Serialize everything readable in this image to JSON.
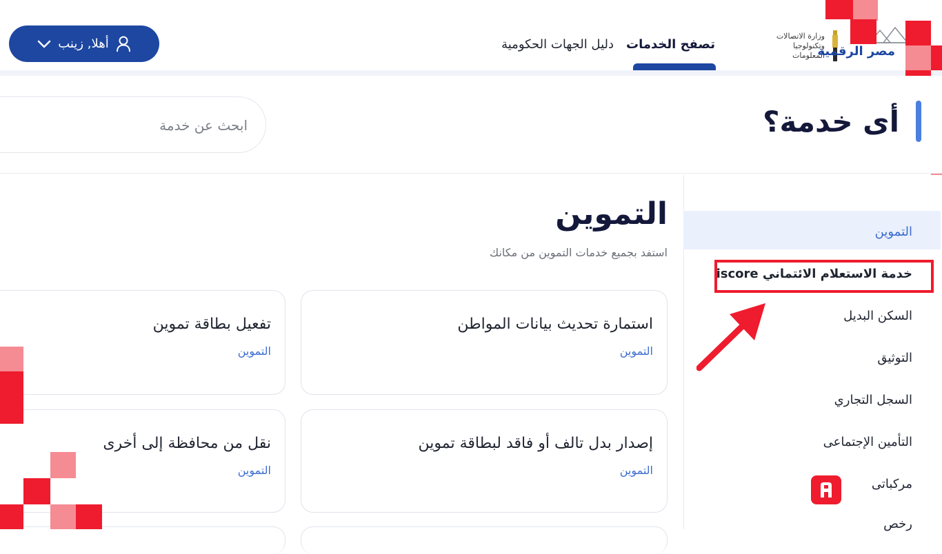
{
  "header": {
    "user_greeting": "أهلا, زينب",
    "nav": {
      "browse_services": "تصفح الخدمات",
      "gov_directory": "دليل الجهات الحكومية"
    },
    "ministry_logo_text": "وزارة الاتصالات\nوتكنولوجيا المعلومات",
    "portal_logo_text": "مصر الرقمية"
  },
  "search": {
    "heading": "أى خدمة؟",
    "placeholder": "ابحث عن خدمة"
  },
  "sidebar": {
    "items": [
      {
        "label": "التموين",
        "active": true
      },
      {
        "label": "خدمة الاستعلام الائتماني iscore",
        "highlighted": true
      },
      {
        "label": "السكن البديل"
      },
      {
        "label": "التوثيق"
      },
      {
        "label": "السجل التجاري"
      },
      {
        "label": "التأمين الإجتماعى"
      },
      {
        "label": "مركباتى",
        "icon": "car-app-icon"
      },
      {
        "label": "رخص"
      }
    ]
  },
  "category": {
    "title": "التموين",
    "subtitle": "استفد بجميع خدمات التموين من مكانك"
  },
  "cards": [
    {
      "title": "استمارة تحديث بيانات المواطن",
      "tag": "التموين"
    },
    {
      "title": "تفعيل بطاقة تموين",
      "tag": "التموين"
    },
    {
      "title": "إصدار بدل تالف أو فاقد لبطاقة تموين",
      "tag": "التموين"
    },
    {
      "title": "نقل من محافظة إلى أخرى",
      "tag": "التموين"
    }
  ],
  "colors": {
    "primary": "#1d47a1",
    "accent_red": "#ee1c2e",
    "active_bg": "#eaf0fc",
    "link_blue": "#3b6bd0"
  }
}
